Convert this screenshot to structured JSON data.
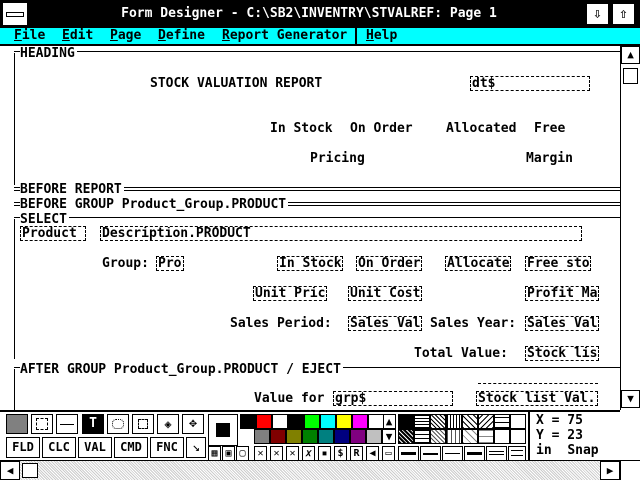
{
  "window": {
    "title": "Form Designer - C:\\SB2\\INVENTRY\\STVALREF: Page 1",
    "minimize_glyph": "⇩",
    "maximize_glyph": "⇧"
  },
  "menu": [
    "File",
    "Edit",
    "Page",
    "Define",
    "Report Generator",
    "Help"
  ],
  "bands": {
    "heading": "HEADING",
    "before_report": "BEFORE REPORT",
    "before_group": "BEFORE GROUP Product_Group.PRODUCT",
    "select": "SELECT",
    "after_group": "AFTER GROUP Product_Group.PRODUCT / EJECT"
  },
  "heading": {
    "report_title": "STOCK VALUATION REPORT",
    "date_field": "dt$",
    "col_in_stock": "In Stock",
    "col_on_order": "On Order",
    "col_allocated": "Allocated",
    "col_free": "Free",
    "col_pricing": "Pricing",
    "col_margin": "Margin"
  },
  "select": {
    "product_field": "Product",
    "description_field": "Description.PRODUCT",
    "group_label": "Group:",
    "group_field": "Pro",
    "in_stock_field": "In Stock",
    "on_order_field": "On Order",
    "allocate_field": "Allocate",
    "free_stock_field": "Free sto",
    "unit_price_field": "Unit Pric",
    "unit_cost_field": "Unit Cost",
    "profit_margin_field": "Profit Ma",
    "sales_period_label": "Sales Period:",
    "sales_val_field": "Sales Val",
    "sales_year_label": "Sales Year:",
    "sales_year_field": "Sales Val",
    "total_value_label": "Total Value:",
    "stock_list_field": "Stock lis"
  },
  "after_group": {
    "value_for_label": "Value for",
    "grp_field": "grp$",
    "stock_list_val_field": "Stock list Val."
  },
  "palette": {
    "tools": [
      "FLD",
      "CLC",
      "VAL",
      "CMD",
      "FNC"
    ],
    "colors_top": [
      "#000000",
      "#ff0000",
      "#ffffff",
      "#000000",
      "#00ff00",
      "#00ffff",
      "#ffff00",
      "#ff00ff",
      "#ffffff"
    ],
    "colors_bottom": [
      "#808080",
      "#800000",
      "#808000",
      "#008000",
      "#008080",
      "#000080",
      "#800080",
      "#c0c0c0"
    ],
    "mini_labels": [
      "$",
      "R"
    ]
  },
  "status": {
    "x_label": "X = 75",
    "y_label": "Y = 23",
    "units": "in",
    "snap": "Snap"
  }
}
